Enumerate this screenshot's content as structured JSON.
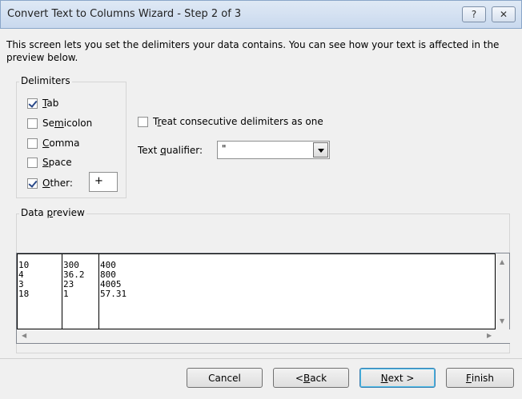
{
  "window": {
    "title": "Convert Text to Columns Wizard - Step 2 of 3",
    "help_label": "?",
    "close_label": "✕"
  },
  "intro": "This screen lets you set the delimiters your data contains.  You can see how your text is affected in the preview below.",
  "delimiters": {
    "legend": "Delimiters",
    "tab": {
      "checked": true,
      "pre": "",
      "accel": "T",
      "post": "ab"
    },
    "semicolon": {
      "checked": false,
      "pre": "Se",
      "accel": "m",
      "post": "icolon"
    },
    "comma": {
      "checked": false,
      "pre": "",
      "accel": "C",
      "post": "omma"
    },
    "space": {
      "checked": false,
      "pre": "",
      "accel": "S",
      "post": "pace"
    },
    "other": {
      "checked": true,
      "pre": "",
      "accel": "O",
      "post": "ther:",
      "value": "+"
    }
  },
  "consecutive": {
    "checked": false,
    "pre": "T",
    "accel": "r",
    "post": "eat consecutive delimiters as one"
  },
  "qualifier": {
    "pre": "Text ",
    "accel": "q",
    "post": "ualifier:",
    "value": "\""
  },
  "preview": {
    "pre": "Data ",
    "accel": "p",
    "post": "review",
    "rows": [
      [
        "10",
        "300",
        "400"
      ],
      [
        "4",
        "36.2",
        "800"
      ],
      [
        "3",
        "23",
        "4005"
      ],
      [
        "18",
        "1",
        "57.31"
      ]
    ]
  },
  "buttons": {
    "cancel": "Cancel",
    "back": {
      "pre": "< ",
      "accel": "B",
      "post": "ack"
    },
    "next": {
      "pre": "",
      "accel": "N",
      "post": "ext >"
    },
    "finish": {
      "pre": "",
      "accel": "F",
      "post": "inish"
    }
  }
}
